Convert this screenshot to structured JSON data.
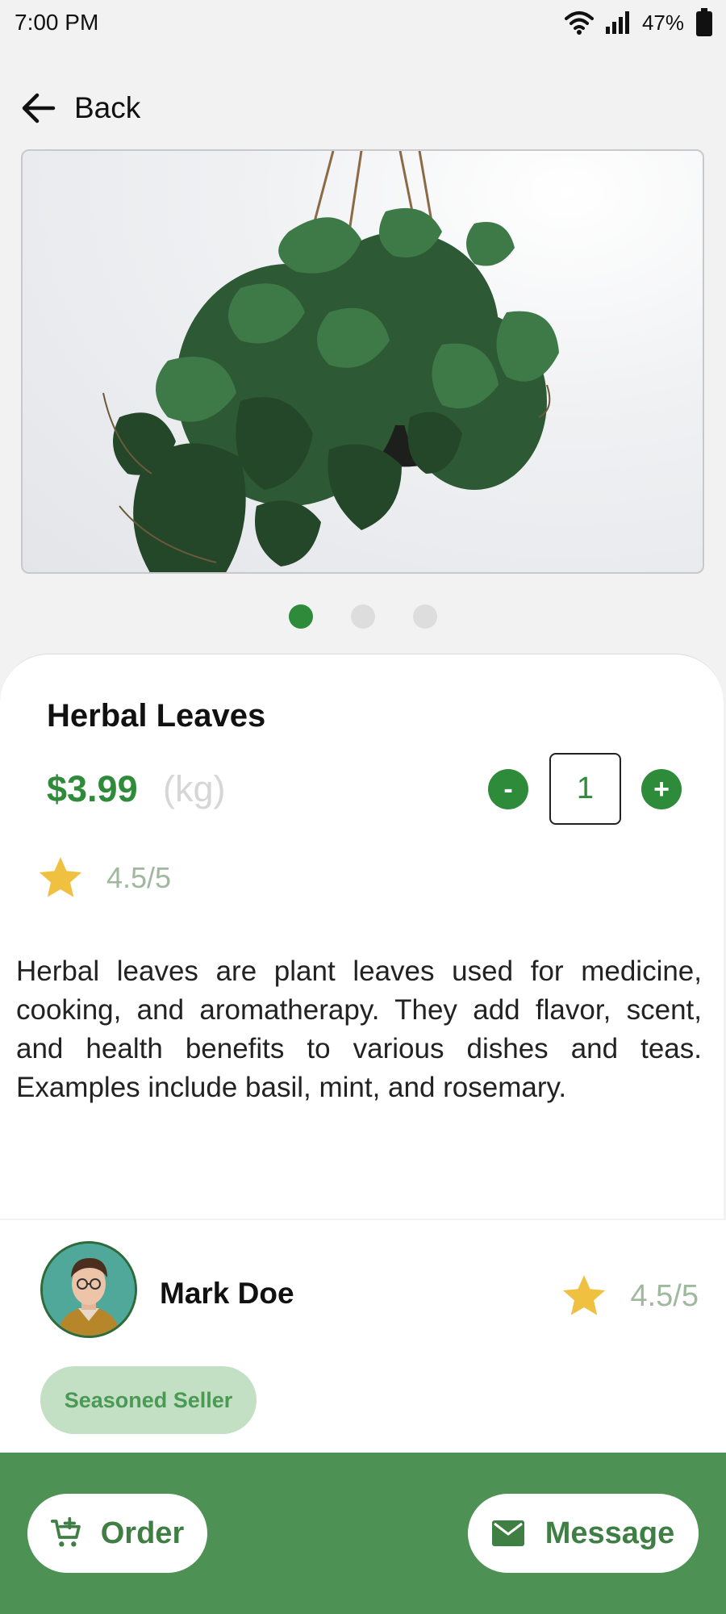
{
  "status_bar": {
    "time": "7:00 PM",
    "battery_percent": "47%",
    "icons": [
      "wifi-icon",
      "signal-icon",
      "battery-icon"
    ]
  },
  "nav": {
    "back_label": "Back",
    "back_icon": "arrow-left-icon"
  },
  "gallery": {
    "image": "hanging-plant-photo",
    "page_count": 3,
    "active_page": 1
  },
  "product": {
    "title": "Herbal Leaves",
    "price": "$3.99",
    "unit": "(kg)",
    "quantity": "1",
    "decrease_label": "-",
    "increase_label": "+",
    "rating": "4.5/5",
    "description": "Herbal leaves are plant leaves used for medicine, cooking, and aromatherapy. They add flavor, scent, and health benefits to various dishes and teas. Examples include basil, mint, and rosemary."
  },
  "seller": {
    "name": "Mark Doe",
    "rating": "4.5/5",
    "badge": "Seasoned Seller"
  },
  "actions": {
    "order_label": "Order",
    "order_icon": "cart-add-icon",
    "message_label": "Message",
    "message_icon": "mail-icon"
  },
  "colors": {
    "accent": "#2e8b3a",
    "bottom_bar": "#4e9155",
    "star": "#f0c040",
    "rating_text": "#9fb89e",
    "badge_bg": "#c3dfc4"
  }
}
